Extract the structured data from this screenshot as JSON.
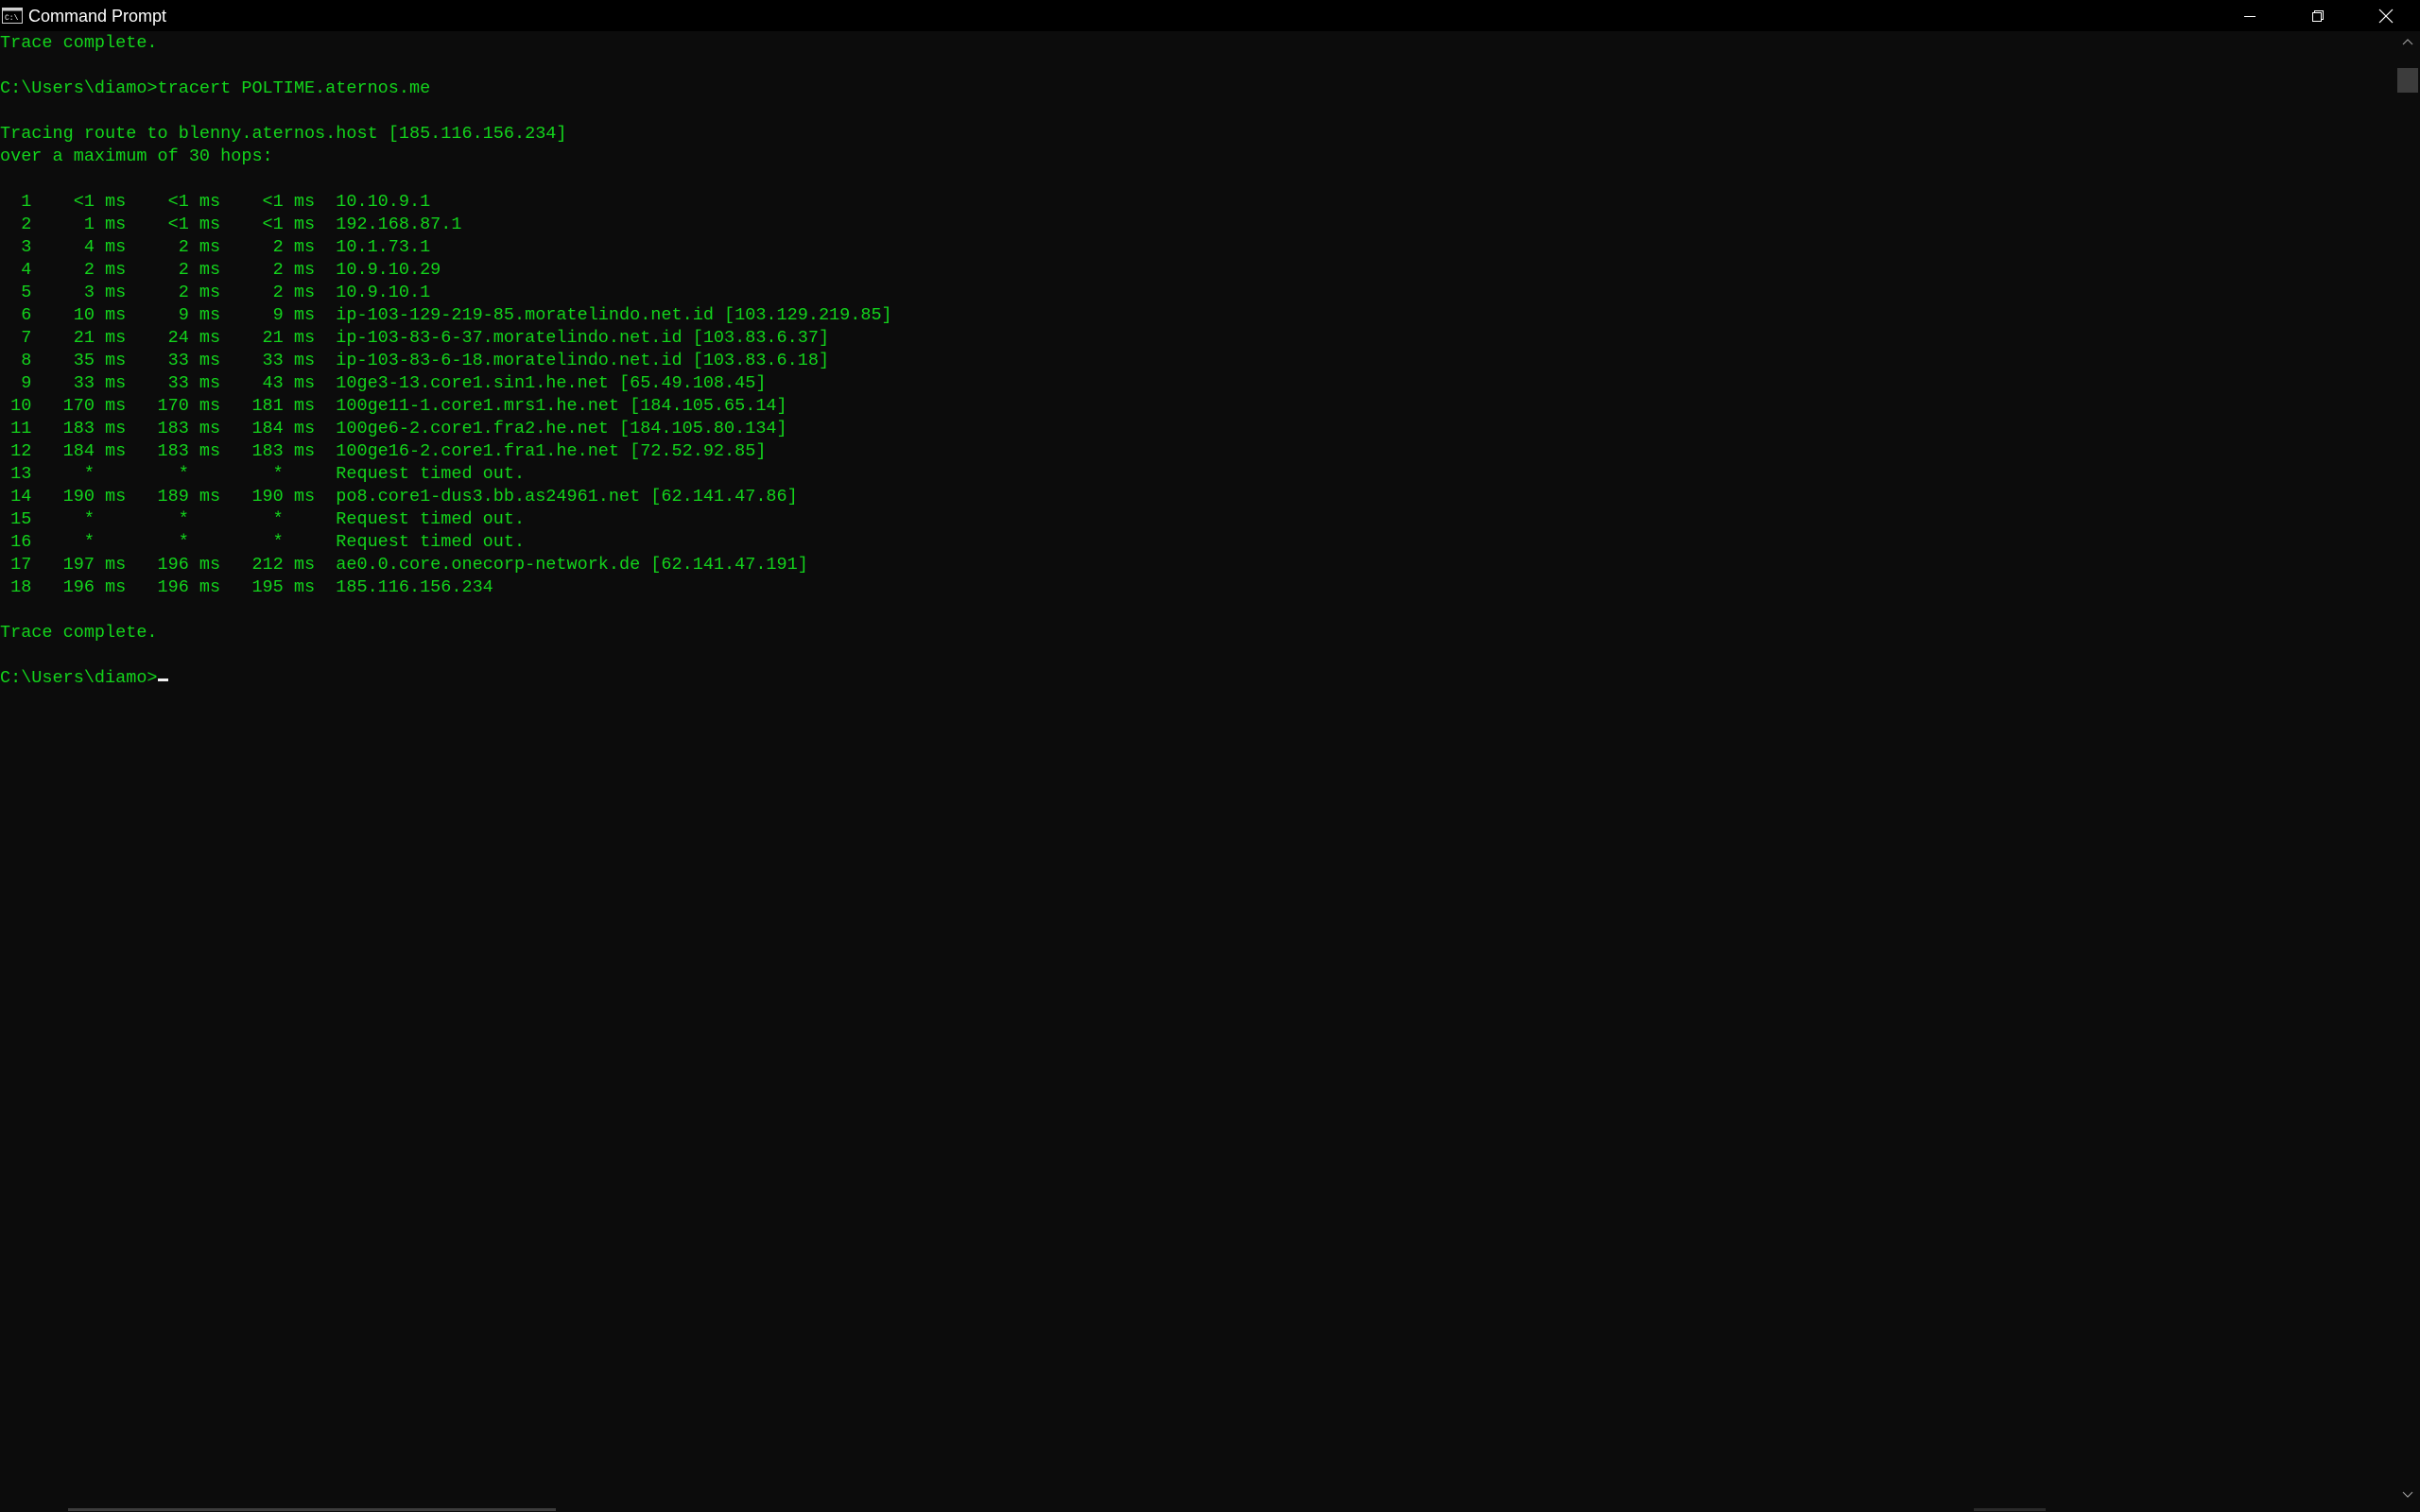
{
  "window": {
    "title": "Command Prompt",
    "icon": "cmd-icon",
    "controls": {
      "minimize_icon": "minimize-icon",
      "restore_icon": "restore-icon",
      "close_icon": "close-icon"
    }
  },
  "colors": {
    "background": "#0c0c0c",
    "text": "#13d41c",
    "titlebar": "#000000"
  },
  "console": {
    "lines": [
      "Trace complete.",
      "",
      "C:\\Users\\diamo>tracert POLTIME.aternos.me",
      "",
      "Tracing route to blenny.aternos.host [185.116.156.234]",
      "over a maximum of 30 hops:",
      "",
      "  1    <1 ms    <1 ms    <1 ms  10.10.9.1",
      "  2     1 ms    <1 ms    <1 ms  192.168.87.1",
      "  3     4 ms     2 ms     2 ms  10.1.73.1",
      "  4     2 ms     2 ms     2 ms  10.9.10.29",
      "  5     3 ms     2 ms     2 ms  10.9.10.1",
      "  6    10 ms     9 ms     9 ms  ip-103-129-219-85.moratelindo.net.id [103.129.219.85]",
      "  7    21 ms    24 ms    21 ms  ip-103-83-6-37.moratelindo.net.id [103.83.6.37]",
      "  8    35 ms    33 ms    33 ms  ip-103-83-6-18.moratelindo.net.id [103.83.6.18]",
      "  9    33 ms    33 ms    43 ms  10ge3-13.core1.sin1.he.net [65.49.108.45]",
      " 10   170 ms   170 ms   181 ms  100ge11-1.core1.mrs1.he.net [184.105.65.14]",
      " 11   183 ms   183 ms   184 ms  100ge6-2.core1.fra2.he.net [184.105.80.134]",
      " 12   184 ms   183 ms   183 ms  100ge16-2.core1.fra1.he.net [72.52.92.85]",
      " 13     *        *        *     Request timed out.",
      " 14   190 ms   189 ms   190 ms  po8.core1-dus3.bb.as24961.net [62.141.47.86]",
      " 15     *        *        *     Request timed out.",
      " 16     *        *        *     Request timed out.",
      " 17   197 ms   196 ms   212 ms  ae0.0.core.onecorp-network.de [62.141.47.191]",
      " 18   196 ms   196 ms   195 ms  185.116.156.234",
      "",
      "Trace complete.",
      ""
    ],
    "prompt": "C:\\Users\\diamo>"
  }
}
